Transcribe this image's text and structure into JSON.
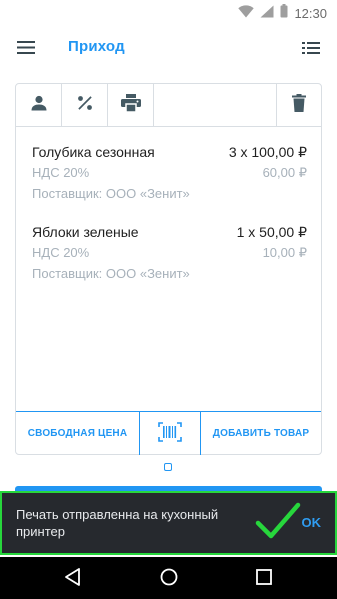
{
  "status": {
    "time": "12:30"
  },
  "header": {
    "title": "Приход"
  },
  "items": [
    {
      "name": "Голубика сезонная",
      "qty_price": "3 x 100,00 ₽",
      "vat_label": "НДС 20%",
      "vat_amount": "60,00 ₽",
      "supplier": "Поставщик: ООО «Зенит»"
    },
    {
      "name": "Яблоки зеленые",
      "qty_price": "1 x 50,00 ₽",
      "vat_label": "НДС 20%",
      "vat_amount": "10,00 ₽",
      "supplier": "Поставщик: ООО «Зенит»"
    }
  ],
  "actions": {
    "free_price": "СВОБОДНАЯ ЦЕНА",
    "add_item": "ДОБАВИТЬ ТОВАР"
  },
  "snackbar": {
    "message": "Печать отправленна на кухонный принтер",
    "action": "OK"
  },
  "colors": {
    "accent": "#2196f3",
    "snackbar_bg": "#26292e",
    "highlight": "#27d63c"
  },
  "icons": [
    "wifi-icon",
    "signal-icon",
    "battery-icon",
    "menu-icon",
    "list-icon",
    "user-icon",
    "percent-icon",
    "printer-icon",
    "trash-icon",
    "barcode-icon",
    "check-icon",
    "back-icon",
    "home-icon",
    "recent-icon"
  ]
}
